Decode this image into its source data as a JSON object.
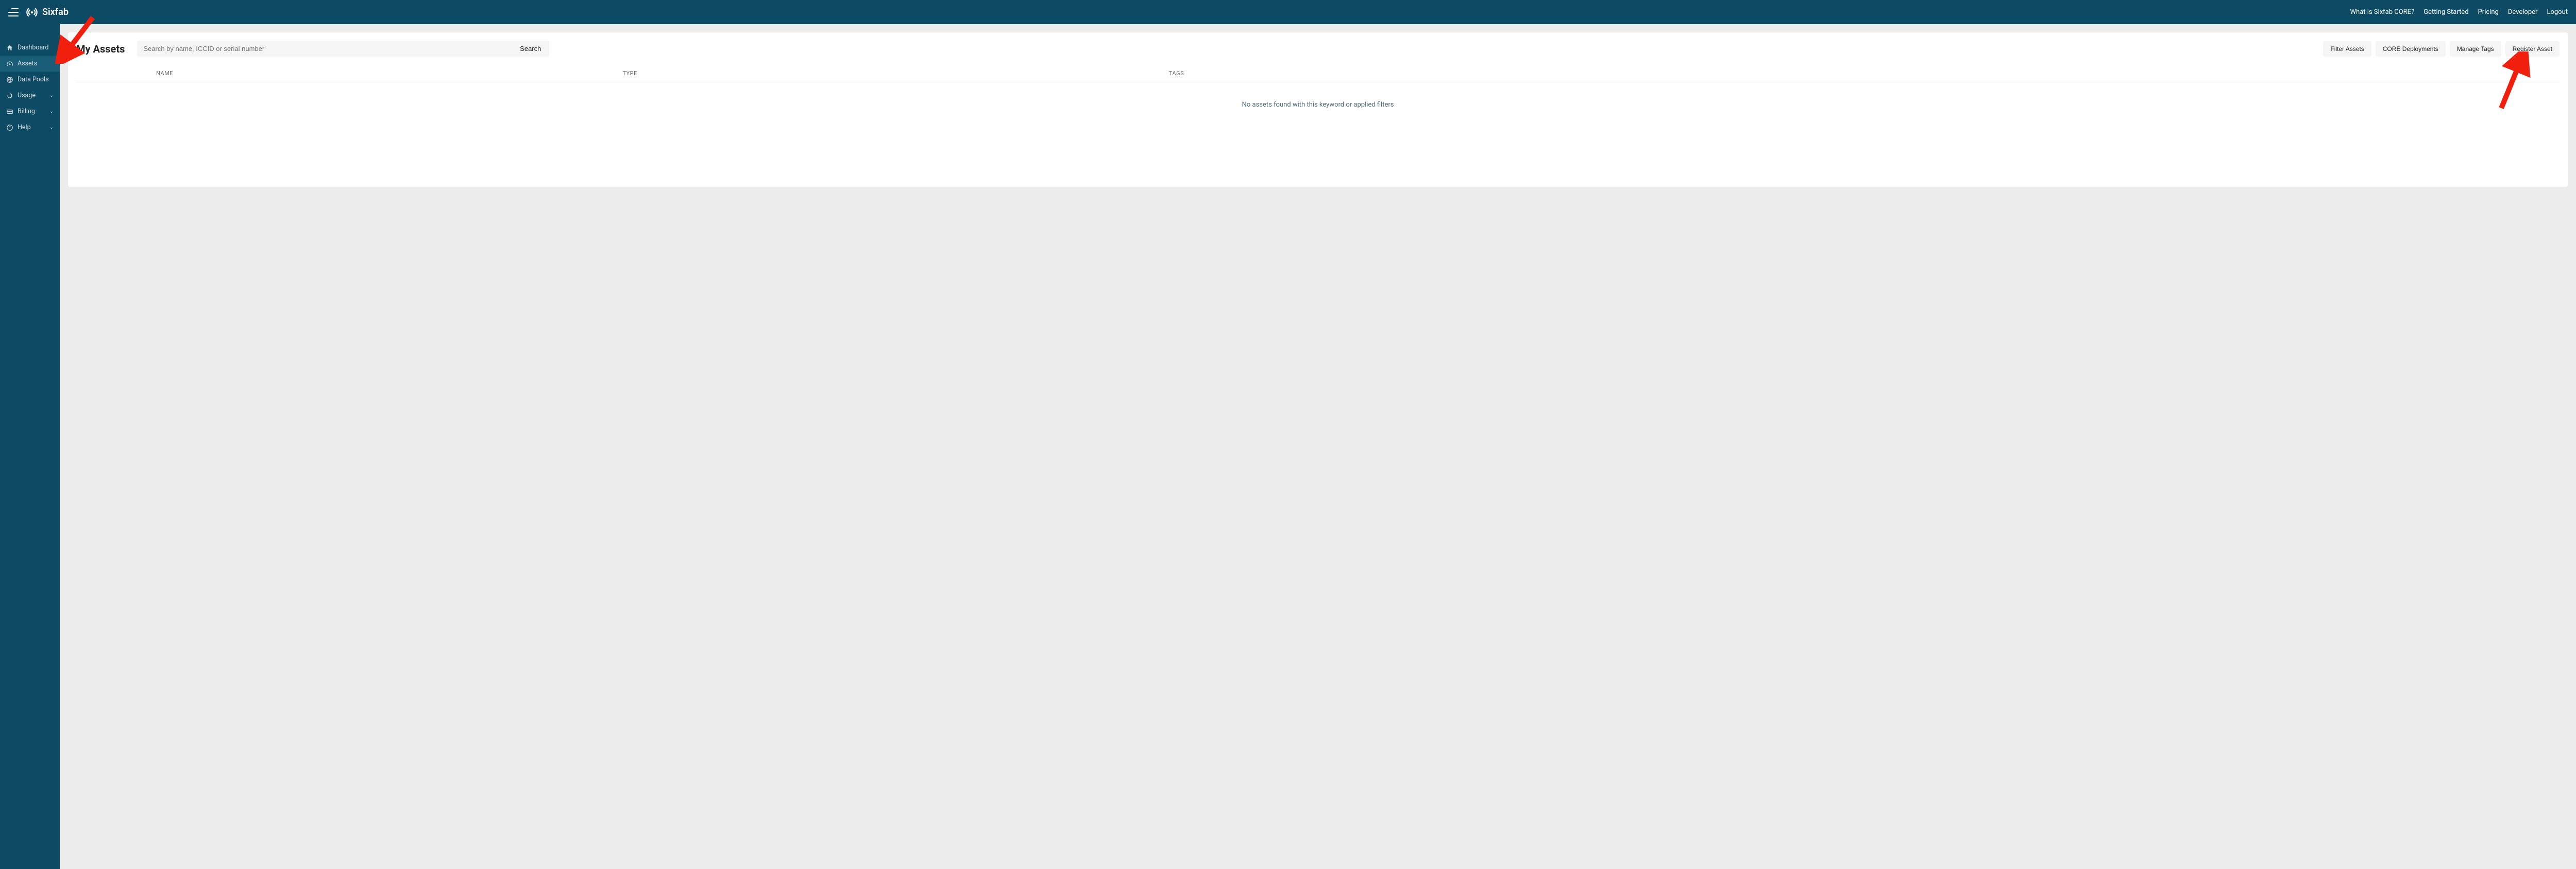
{
  "brand": "Sixfab",
  "header_links": [
    {
      "label": "What is Sixfab CORE?"
    },
    {
      "label": "Getting Started"
    },
    {
      "label": "Pricing"
    },
    {
      "label": "Developer"
    },
    {
      "label": "Logout"
    }
  ],
  "sidebar": {
    "items": [
      {
        "label": "Dashboard",
        "icon": "home-icon",
        "active": false,
        "expandable": false
      },
      {
        "label": "Assets",
        "icon": "speedometer-icon",
        "active": true,
        "expandable": false
      },
      {
        "label": "Data Pools",
        "icon": "globe-icon",
        "active": false,
        "expandable": false
      },
      {
        "label": "Usage",
        "icon": "history-icon",
        "active": false,
        "expandable": true
      },
      {
        "label": "Billing",
        "icon": "card-icon",
        "active": false,
        "expandable": true
      },
      {
        "label": "Help",
        "icon": "help-icon",
        "active": false,
        "expandable": true
      }
    ]
  },
  "page": {
    "title": "My Assets",
    "search_placeholder": "Search by name, ICCID or serial number",
    "search_button": "Search",
    "actions": {
      "filter": "Filter Assets",
      "core": "CORE Deployments",
      "tags": "Manage Tags",
      "register": "Register Asset"
    },
    "columns": {
      "name": "NAME",
      "type": "TYPE",
      "tags": "TAGS"
    },
    "empty_message": "No assets found with this keyword or applied filters"
  },
  "colors": {
    "brand_bg": "#0d4a63",
    "arrow": "#f01f0e"
  }
}
